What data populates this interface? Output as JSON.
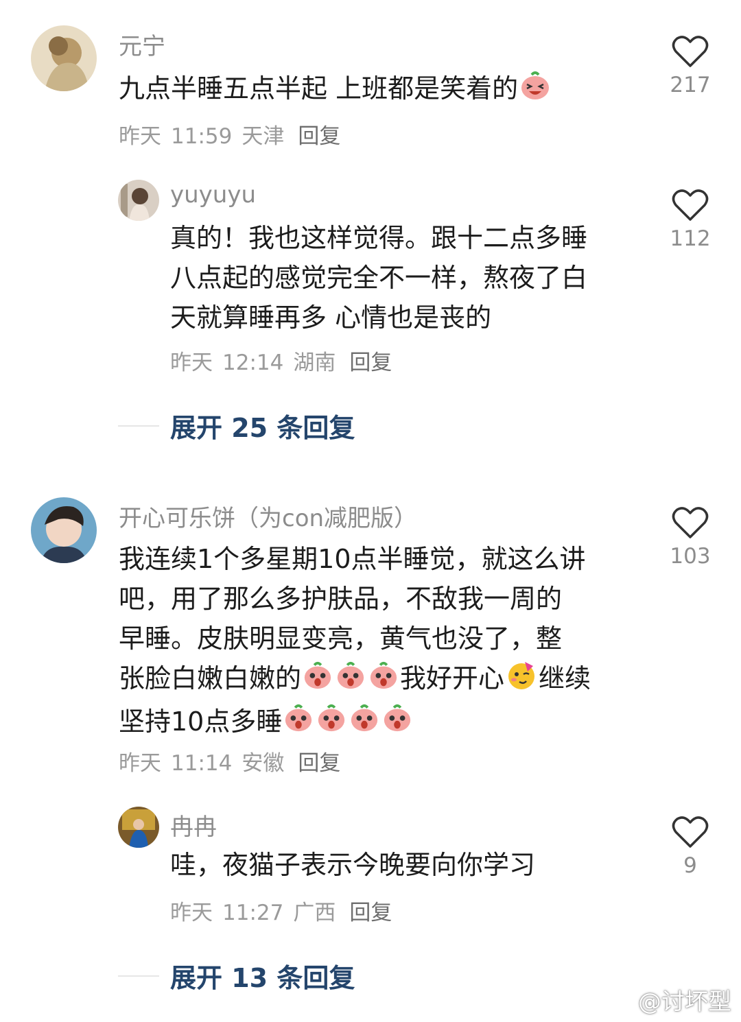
{
  "comments": [
    {
      "user": "元宁",
      "text": "九点半睡五点半起 上班都是笑着的",
      "emoji": [
        "laugh-peach-emoji"
      ],
      "date": "昨天",
      "time": "11:59",
      "location": "天津",
      "reply_label": "回复",
      "likes": "217",
      "replies": [
        {
          "user": "yuyuyu",
          "text_lines": [
            "真的！我也这样觉得。跟十二点多睡",
            "八点起的感觉完全不一样，熬夜了白",
            "天就算睡再多 心情也是丧的"
          ],
          "date": "昨天",
          "time": "12:14",
          "location": "湖南",
          "reply_label": "回复",
          "likes": "112"
        }
      ],
      "expand_label": "展开 25 条回复"
    },
    {
      "user": "开心可乐饼（为con减肥版）",
      "text_lines": [
        "我连续1个多星期10点半睡觉，就这么讲",
        "吧，用了那么多护肤品，不敌我一周的",
        "早睡。皮肤明显变亮，黄气也没了，整"
      ],
      "line4_a": "张脸白嫩白嫩的",
      "line4_b": "我好开心",
      "line4_c": "继续",
      "line5": "坚持10点多睡",
      "emoji": [
        "wow-peach-emoji",
        "party-face-emoji"
      ],
      "date": "昨天",
      "time": "11:14",
      "location": "安徽",
      "reply_label": "回复",
      "likes": "103",
      "replies": [
        {
          "user": "冉冉",
          "text": "哇，夜猫子表示今晚要向你学习",
          "date": "昨天",
          "time": "11:27",
          "location": "广西",
          "reply_label": "回复",
          "likes": "9"
        }
      ],
      "expand_label": "展开 13 条回复"
    }
  ],
  "watermark": "@讨坏型",
  "colors": {
    "link": "#24456c",
    "meta": "#9a9a9a",
    "text": "#1c1c1c"
  }
}
